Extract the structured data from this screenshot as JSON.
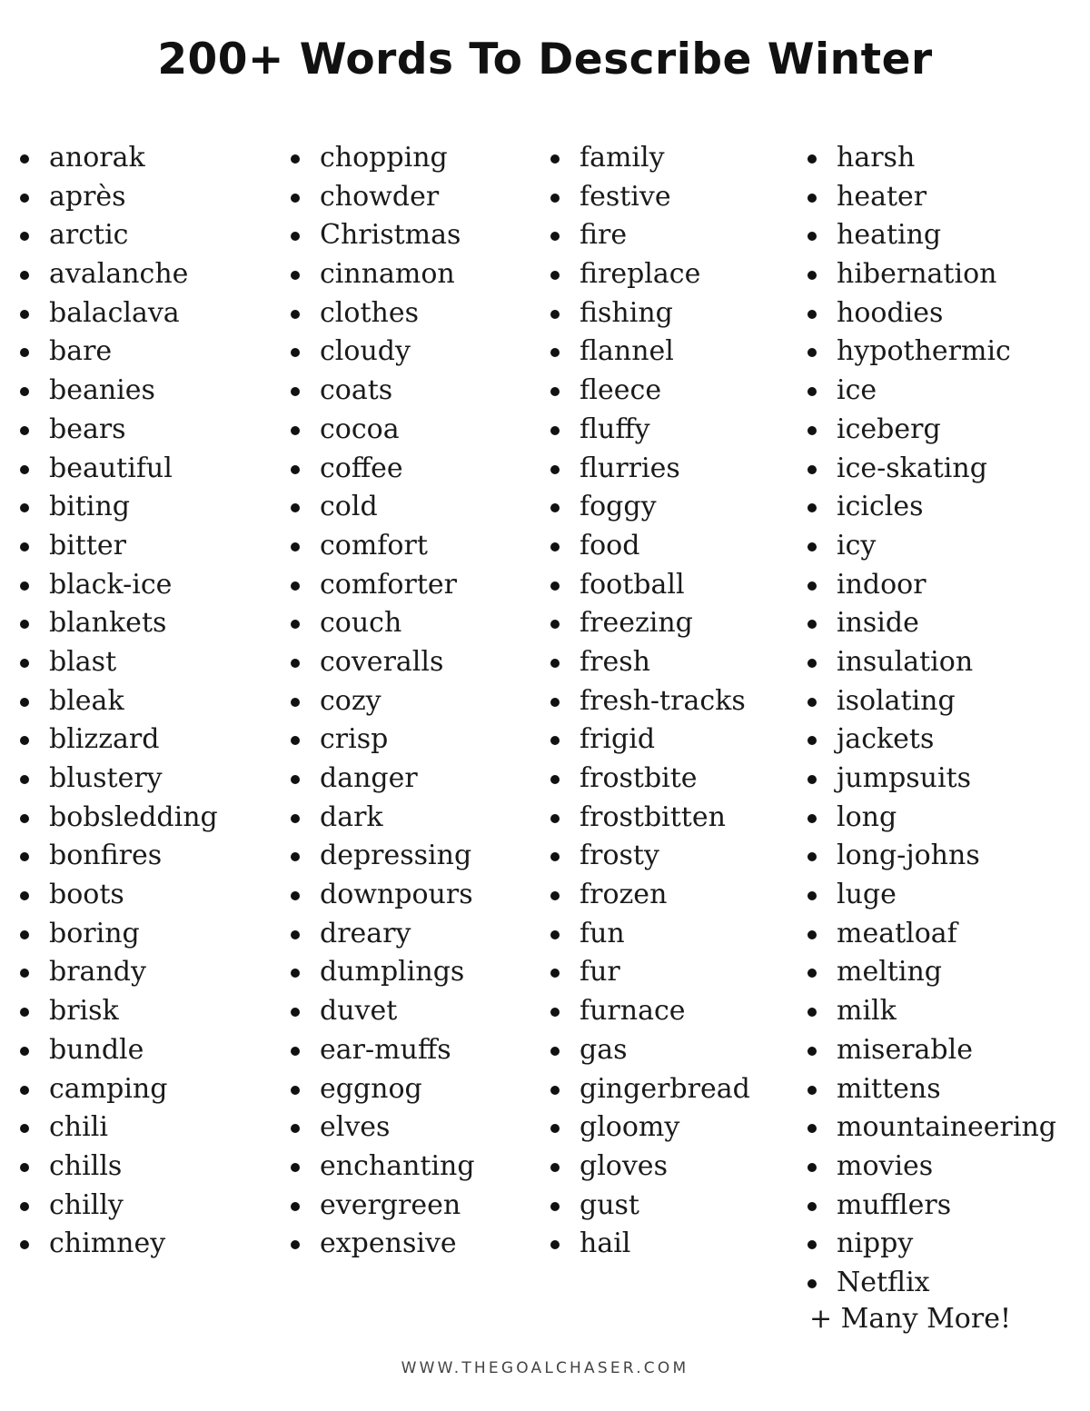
{
  "title": "200+ Words To Describe Winter",
  "columns": [
    [
      "anorak",
      "après",
      "arctic",
      "avalanche",
      "balaclava",
      "bare",
      "beanies",
      "bears",
      "beautiful",
      "biting",
      "bitter",
      "black-ice",
      "blankets",
      "blast",
      "bleak",
      "blizzard",
      "blustery",
      "bobsledding",
      "bonfires",
      "boots",
      "boring",
      "brandy",
      "brisk",
      "bundle",
      "camping",
      "chili",
      "chills",
      "chilly",
      "chimney"
    ],
    [
      "chopping",
      "chowder",
      "Christmas",
      "cinnamon",
      "clothes",
      "cloudy",
      "coats",
      "cocoa",
      "coffee",
      "cold",
      "comfort",
      "comforter",
      "couch",
      "coveralls",
      "cozy",
      "crisp",
      "danger",
      "dark",
      "depressing",
      "downpours",
      "dreary",
      "dumplings",
      "duvet",
      "ear-muffs",
      "eggnog",
      "elves",
      "enchanting",
      "evergreen",
      "expensive"
    ],
    [
      "family",
      "festive",
      "fire",
      "fireplace",
      "fishing",
      "flannel",
      "fleece",
      "fluffy",
      "flurries",
      "foggy",
      "food",
      "football",
      "freezing",
      "fresh",
      "fresh-tracks",
      "frigid",
      "frostbite",
      "frostbitten",
      "frosty",
      "frozen",
      "fun",
      "fur",
      "furnace",
      "gas",
      "gingerbread",
      "gloomy",
      "gloves",
      "gust",
      "hail"
    ],
    [
      "harsh",
      "heater",
      "heating",
      "hibernation",
      "hoodies",
      "hypothermic",
      "ice",
      "iceberg",
      "ice-skating",
      "icicles",
      "icy",
      "indoor",
      "inside",
      "insulation",
      "isolating",
      "jackets",
      "jumpsuits",
      "long",
      "long-johns",
      "luge",
      "meatloaf",
      "melting",
      "milk",
      "miserable",
      "mittens",
      "mountaineering",
      "movies",
      "mufflers",
      "nippy",
      "Netflix"
    ]
  ],
  "more_text": "+ Many More!",
  "footer": "WWW.THEGOALCHASER.COM"
}
